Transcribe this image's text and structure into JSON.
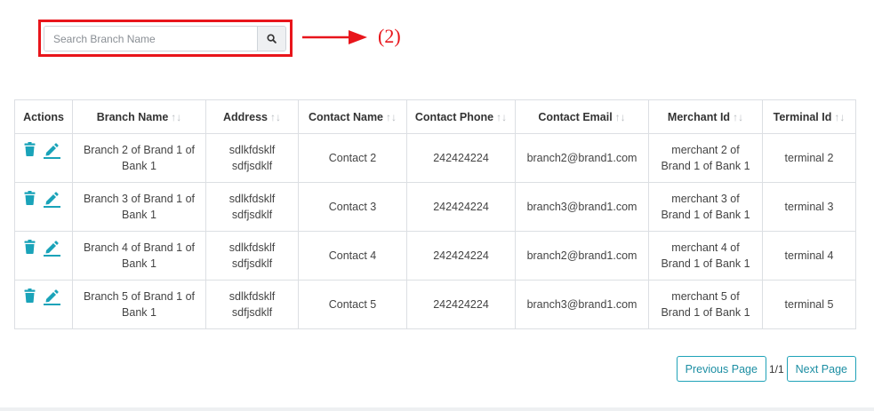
{
  "search": {
    "placeholder": "Search Branch Name",
    "value": ""
  },
  "annotation": {
    "label": "(2)"
  },
  "colors": {
    "accent": "#1fa2b8",
    "highlight": "#e8151b"
  },
  "table": {
    "headers": [
      "Actions",
      "Branch Name",
      "Address",
      "Contact Name",
      "Contact Phone",
      "Contact Email",
      "Merchant Id",
      "Terminal Id"
    ],
    "rows": [
      {
        "branch_name": "Branch 2 of Brand 1 of Bank 1",
        "address": "sdlkfdsklf sdfjsdklf",
        "contact_name": "Contact 2",
        "contact_phone": "242424224",
        "contact_email": "branch2@brand1.com",
        "merchant_id": "merchant 2 of Brand 1 of Bank 1",
        "terminal_id": "terminal 2"
      },
      {
        "branch_name": "Branch 3 of Brand 1 of Bank 1",
        "address": "sdlkfdsklf sdfjsdklf",
        "contact_name": "Contact 3",
        "contact_phone": "242424224",
        "contact_email": "branch3@brand1.com",
        "merchant_id": "merchant 3 of Brand 1 of Bank 1",
        "terminal_id": "terminal 3"
      },
      {
        "branch_name": "Branch 4 of Brand 1 of Bank 1",
        "address": "sdlkfdsklf sdfjsdklf",
        "contact_name": "Contact 4",
        "contact_phone": "242424224",
        "contact_email": "branch2@brand1.com",
        "merchant_id": "merchant 4 of Brand 1 of Bank 1",
        "terminal_id": "terminal 4"
      },
      {
        "branch_name": "Branch 5 of Brand 1 of Bank 1",
        "address": "sdlkfdsklf sdfjsdklf",
        "contact_name": "Contact 5",
        "contact_phone": "242424224",
        "contact_email": "branch3@brand1.com",
        "merchant_id": "merchant 5 of Brand 1 of Bank 1",
        "terminal_id": "terminal 5"
      }
    ]
  },
  "pagination": {
    "prev_label": "Previous Page",
    "page_count": "1/1",
    "next_label": "Next Page"
  }
}
